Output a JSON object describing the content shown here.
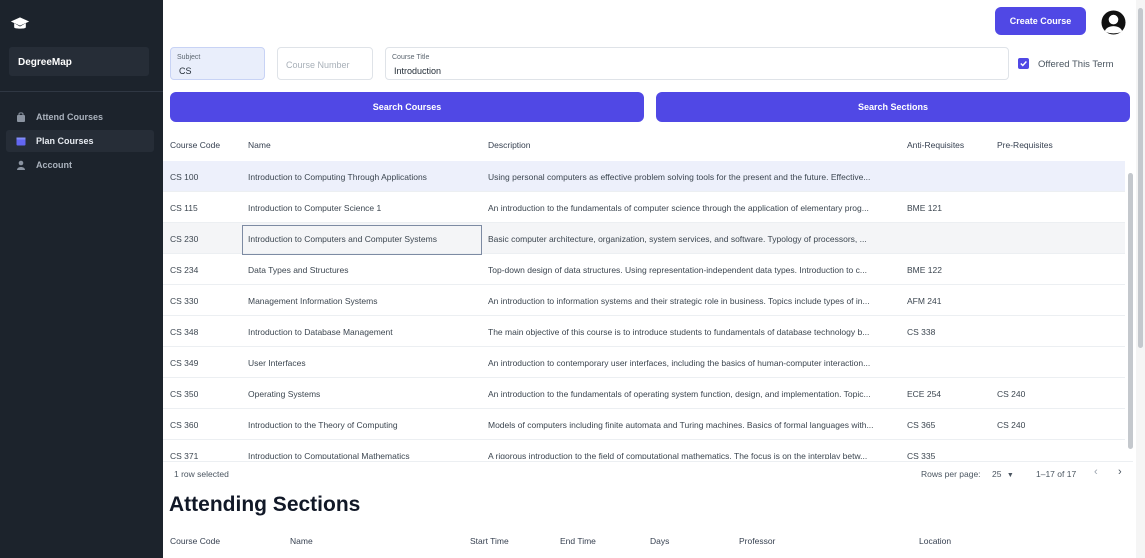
{
  "sidebar": {
    "brand": "DegreeMap",
    "items": [
      {
        "label": "Attend Courses",
        "icon": "bag-icon"
      },
      {
        "label": "Plan Courses",
        "icon": "calendar-icon"
      },
      {
        "label": "Account",
        "icon": "user-icon"
      }
    ]
  },
  "header": {
    "create_label": "Create Course"
  },
  "filters": {
    "subject": {
      "label": "Subject",
      "value": "CS"
    },
    "number": {
      "placeholder": "Course Number"
    },
    "title": {
      "label": "Course Title",
      "value": "Introduction"
    },
    "offered": {
      "label": "Offered This Term",
      "checked": true
    }
  },
  "buttons": {
    "search_courses": "Search Courses",
    "search_sections": "Search Sections"
  },
  "table": {
    "columns": [
      "Course Code",
      "Name",
      "Description",
      "Anti-Requisites",
      "Pre-Requisites"
    ],
    "rows": [
      {
        "code": "CS 100",
        "name": "Introduction to Computing Through Applications",
        "desc": "Using personal computers as effective problem solving tools for the present and the future. Effective...",
        "anti": "",
        "pre": ""
      },
      {
        "code": "CS 115",
        "name": "Introduction to Computer Science 1",
        "desc": "An introduction to the fundamentals of computer science through the application of elementary prog...",
        "anti": "BME 121",
        "pre": ""
      },
      {
        "code": "CS 230",
        "name": "Introduction to Computers and Computer Systems",
        "desc": "Basic computer architecture, organization, system services, and software. Typology of processors, ...",
        "anti": "",
        "pre": ""
      },
      {
        "code": "CS 234",
        "name": "Data Types and Structures",
        "desc": "Top-down design of data structures. Using representation-independent data types. Introduction to c...",
        "anti": "BME 122",
        "pre": ""
      },
      {
        "code": "CS 330",
        "name": "Management Information Systems",
        "desc": "An introduction to information systems and their strategic role in business. Topics include types of in...",
        "anti": "AFM 241",
        "pre": ""
      },
      {
        "code": "CS 348",
        "name": "Introduction to Database Management",
        "desc": "The main objective of this course is to introduce students to fundamentals of database technology b...",
        "anti": "CS 338",
        "pre": ""
      },
      {
        "code": "CS 349",
        "name": "User Interfaces",
        "desc": "An introduction to contemporary user interfaces, including the basics of human-computer interaction...",
        "anti": "",
        "pre": ""
      },
      {
        "code": "CS 350",
        "name": "Operating Systems",
        "desc": "An introduction to the fundamentals of operating system function, design, and implementation. Topic...",
        "anti": "ECE 254",
        "pre": "CS 240"
      },
      {
        "code": "CS 360",
        "name": "Introduction to the Theory of Computing",
        "desc": "Models of computers including finite automata and Turing machines. Basics of formal languages with...",
        "anti": "CS 365",
        "pre": "CS 240"
      },
      {
        "code": "CS 371",
        "name": "Introduction to Computational Mathematics",
        "desc": "A rigorous introduction to the field of computational mathematics. The focus is on the interplay betw...",
        "anti": "CS 335",
        "pre": ""
      }
    ]
  },
  "footer": {
    "selected": "1 row selected",
    "rows_per_page_label": "Rows per page:",
    "rows_per_page": "25",
    "range": "1–17 of 17"
  },
  "attending": {
    "title": "Attending Sections",
    "columns": [
      "Course Code",
      "Name",
      "Start Time",
      "End Time",
      "Days",
      "Professor",
      "Location"
    ]
  },
  "colors": {
    "accent": "#5048e5",
    "sidebar": "#1c232c"
  }
}
